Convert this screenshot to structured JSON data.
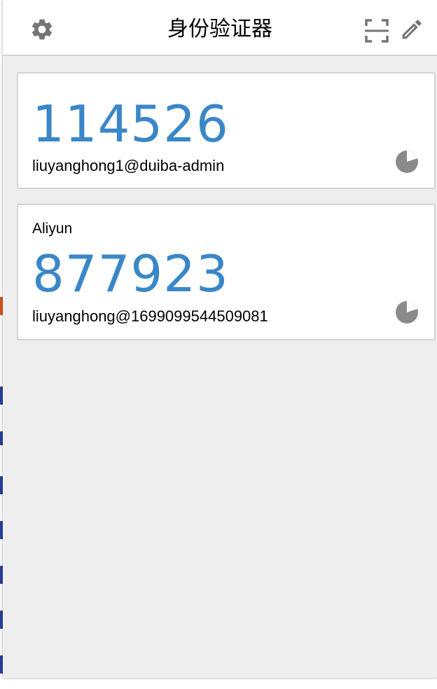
{
  "header": {
    "title": "身份验证器",
    "settings_icon": "gear-icon",
    "scan_icon": "scan-qr-icon",
    "edit_icon": "pencil-icon"
  },
  "entries": [
    {
      "issuer": "",
      "code": "114526",
      "account": "liuyanghong1@duiba-admin",
      "timer_icon": "countdown-pie-icon",
      "time_elapsed_fraction": 0.3
    },
    {
      "issuer": "Aliyun",
      "code": "877923",
      "account": "liuyanghong@1699099544509081",
      "timer_icon": "countdown-pie-icon",
      "time_elapsed_fraction": 0.3
    }
  ],
  "colors": {
    "code": "#3a87c8",
    "background": "#eeeeee",
    "icon": "#757575",
    "timer": "#8a8a8a",
    "card_border": "#d3d3d3"
  }
}
